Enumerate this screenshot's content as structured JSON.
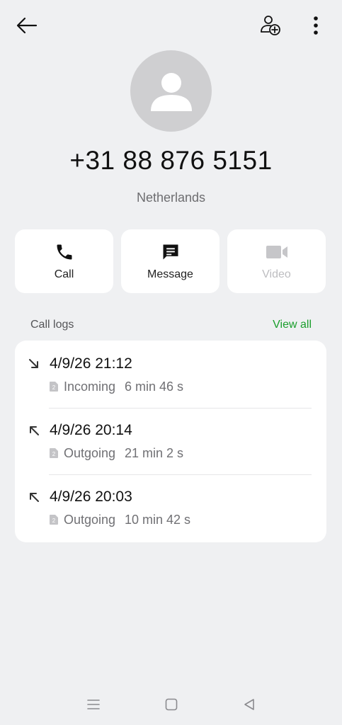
{
  "contact": {
    "phone_number": "+31 88 876 5151",
    "country": "Netherlands"
  },
  "actions": [
    {
      "label": "Call",
      "icon": "phone-icon",
      "enabled": true
    },
    {
      "label": "Message",
      "icon": "message-icon",
      "enabled": true
    },
    {
      "label": "Video",
      "icon": "video-icon",
      "enabled": false
    }
  ],
  "call_logs": {
    "title": "Call logs",
    "view_all_label": "View all",
    "entries": [
      {
        "datetime": "4/9/26 21:12",
        "direction": "incoming",
        "type": "Incoming",
        "duration": "6 min 46 s",
        "sim": "2"
      },
      {
        "datetime": "4/9/26 20:14",
        "direction": "outgoing",
        "type": "Outgoing",
        "duration": "21 min 2 s",
        "sim": "2"
      },
      {
        "datetime": "4/9/26 20:03",
        "direction": "outgoing",
        "type": "Outgoing",
        "duration": "10 min 42 s",
        "sim": "2"
      }
    ]
  },
  "colors": {
    "background": "#eff0f2",
    "card": "#ffffff",
    "accent_green": "#1a9e2c",
    "avatar_bg": "#cfcfd1"
  }
}
